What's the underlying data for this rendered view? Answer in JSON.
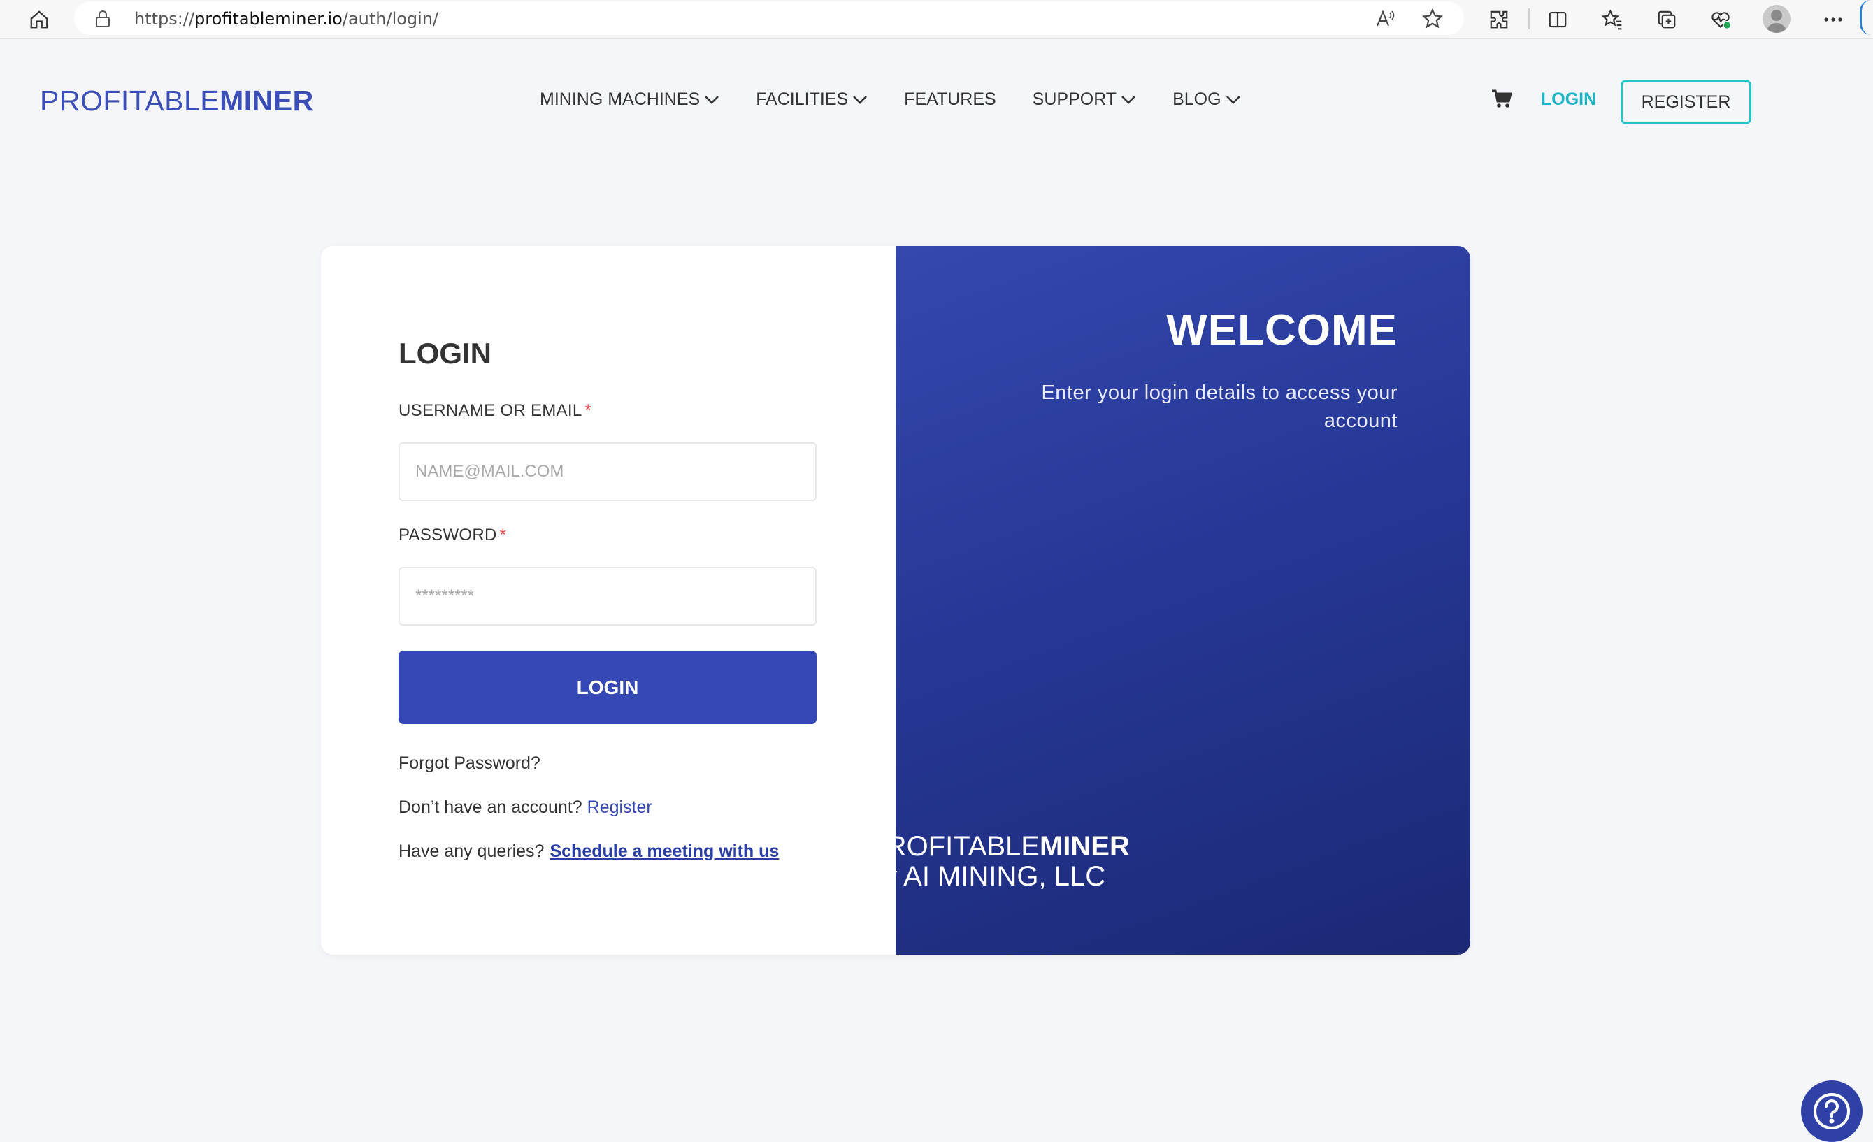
{
  "browser": {
    "url_prefix": "https://",
    "url_domain": "profitableminer.io",
    "url_path": "/auth/login/"
  },
  "header": {
    "logo_light": "PROFITABLE",
    "logo_bold": "MINER",
    "nav": [
      {
        "label": "MINING MACHINES",
        "has_dropdown": true
      },
      {
        "label": "FACILITIES",
        "has_dropdown": true
      },
      {
        "label": "FEATURES",
        "has_dropdown": false
      },
      {
        "label": "SUPPORT",
        "has_dropdown": true
      },
      {
        "label": "BLOG",
        "has_dropdown": true
      }
    ],
    "login_label": "LOGIN",
    "register_label": "REGISTER"
  },
  "form": {
    "title": "LOGIN",
    "username_label": "USERNAME OR EMAIL",
    "username_placeholder": "NAME@MAIL.COM",
    "password_label": "PASSWORD",
    "password_placeholder": "*********",
    "required_mark": "*",
    "submit_label": "LOGIN",
    "forgot_label": "Forgot Password?",
    "no_account_text": "Don’t have an account?",
    "register_link": "Register",
    "queries_text": "Have any queries?",
    "meeting_link": "Schedule a meeting with us"
  },
  "welcome": {
    "title": "WELCOME",
    "subtitle": "Enter your login details to access your account",
    "brand_light": "PROFITABLE",
    "brand_bold": "MINER",
    "company": "by AI MINING, LLC"
  },
  "colors": {
    "brand_blue": "#3c4fb8",
    "button_blue": "#3648b5",
    "teal_accent": "#1cb6c4",
    "required_red": "#e04848"
  }
}
